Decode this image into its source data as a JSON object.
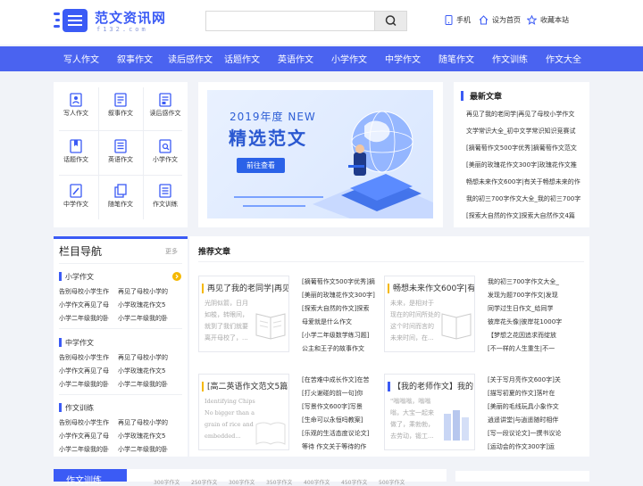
{
  "header": {
    "logo_text": "范文资讯网",
    "logo_sub": "f132.com",
    "search_placeholder": "",
    "links": [
      {
        "label": "手机",
        "icon": "phone-icon"
      },
      {
        "label": "设为首页",
        "icon": "home-icon"
      },
      {
        "label": "收藏本站",
        "icon": "star-icon"
      }
    ]
  },
  "nav": [
    "写人作文",
    "叙事作文",
    "读后感作文",
    "话题作文",
    "英语作文",
    "小学作文",
    "中学作文",
    "随笔作文",
    "作文训练",
    "作文大全"
  ],
  "categories": [
    "写人作文",
    "叙事作文",
    "读后感作文",
    "话题作文",
    "英语作文",
    "小学作文",
    "中学作文",
    "随笔作文",
    "作文训练"
  ],
  "banner": {
    "year": "2019年度 NEW",
    "title": "精选范文",
    "button": "前往查看"
  },
  "latest": {
    "title": "最新文章",
    "items": [
      "再见了我的老同学|再见了母校小学作文",
      "文学常识大全_初中文学常识知识竞赛试",
      "[摘葡萄作文500字优秀]摘葡萄作文范文",
      "[美丽的玫瑰花作文300字]玫瑰花作文推",
      "畅想未来作文600字|有关于畅想未来的作",
      "我的初三700字作文大全_我的初三700字",
      "[探索大自然的作文]探索大自然作文4篇"
    ]
  },
  "column_nav": {
    "title": "栏目导航",
    "more": "更多",
    "groups": [
      {
        "name": "小学作文",
        "rows": [
          [
            "告别母校小学生作",
            "再见了母校小学的"
          ],
          [
            "小学作文再见了母",
            "小学玫瑰花作文5"
          ],
          [
            "小学二年级我的卧",
            "小学二年级我的卧"
          ]
        ]
      },
      {
        "name": "中学作文",
        "rows": [
          [
            "告别母校小学生作",
            "再见了母校小学的"
          ],
          [
            "小学作文再见了母",
            "小学玫瑰花作文5"
          ],
          [
            "小学二年级我的卧",
            "小学二年级我的卧"
          ]
        ]
      },
      {
        "name": "作文训练",
        "rows": [
          [
            "告别母校小学生作",
            "再见了母校小学的"
          ],
          [
            "小学作文再见了母",
            "小学玫瑰花作文5"
          ],
          [
            "小学二年级我的卧",
            "小学二年级我的卧"
          ]
        ]
      }
    ]
  },
  "recommend": {
    "title": "推荐文章",
    "cards": [
      {
        "title": "再见了我的老同学|再见",
        "excerpt": "光阴似箭，日月\n如梭，转眼间，\n就到了我们就要\n离开母校了，..."
      },
      {
        "title": "畅想未来作文600字|有",
        "excerpt": "未来，是相对于\n现在的时间所处的\n这个时间而言的\n未来时间，在..."
      },
      {
        "title": "[高二英语作文范文5篇",
        "excerpt": "Identifying Chips\nNo bigger than a\ngrain of rice and\nembedded..."
      },
      {
        "title": "【我的老师作文】我的",
        "excerpt": "\"嗡嗡嗡，嗡嗡\n嗡，大宝一起来\n做了，乘勃勃，\n去劳动，锻工..."
      }
    ],
    "list1": [
      "[摘葡萄作文500字优秀]摘",
      "[美丽的玫瑰花作文300字]",
      "[探索大自然的作文]探索",
      "母爱就是什么作文",
      "[小学二年级数学练习题]",
      "公主和王子的故事作文"
    ],
    "list2": [
      "我的初三700字作文大全_",
      "发现为题700字作文|发现",
      "同学过生日作文_给同学",
      "彼岸花头像|彼岸花1000字",
      "【梦想之花因追求而绽放",
      "[不一样的人生重生|不一"
    ],
    "list3": [
      "[在苦难中成长作文]在苦",
      "[打火谢碰的前一句]你",
      "[写景作文600字]写景",
      "[生命可以永恒吗教案]",
      "[乐观的生活态度议论文]",
      "等待 作文关于等待的作"
    ],
    "list4": [
      "[关于写月亮作文600字]关",
      "[描写初夏的作文]落叶在",
      "[美丽的毛线玩具小象作文",
      "逍遥讲堂|与逍遥随时相伴",
      "[写一段议论文]一撰书议论",
      "[运动会的作文300字]运"
    ]
  },
  "bottom": {
    "tab": "作文训练",
    "links": [
      "300字作文",
      "250字作文",
      "300字作文",
      "350字作文",
      "400字作文",
      "450字作文",
      "500字作文"
    ]
  }
}
